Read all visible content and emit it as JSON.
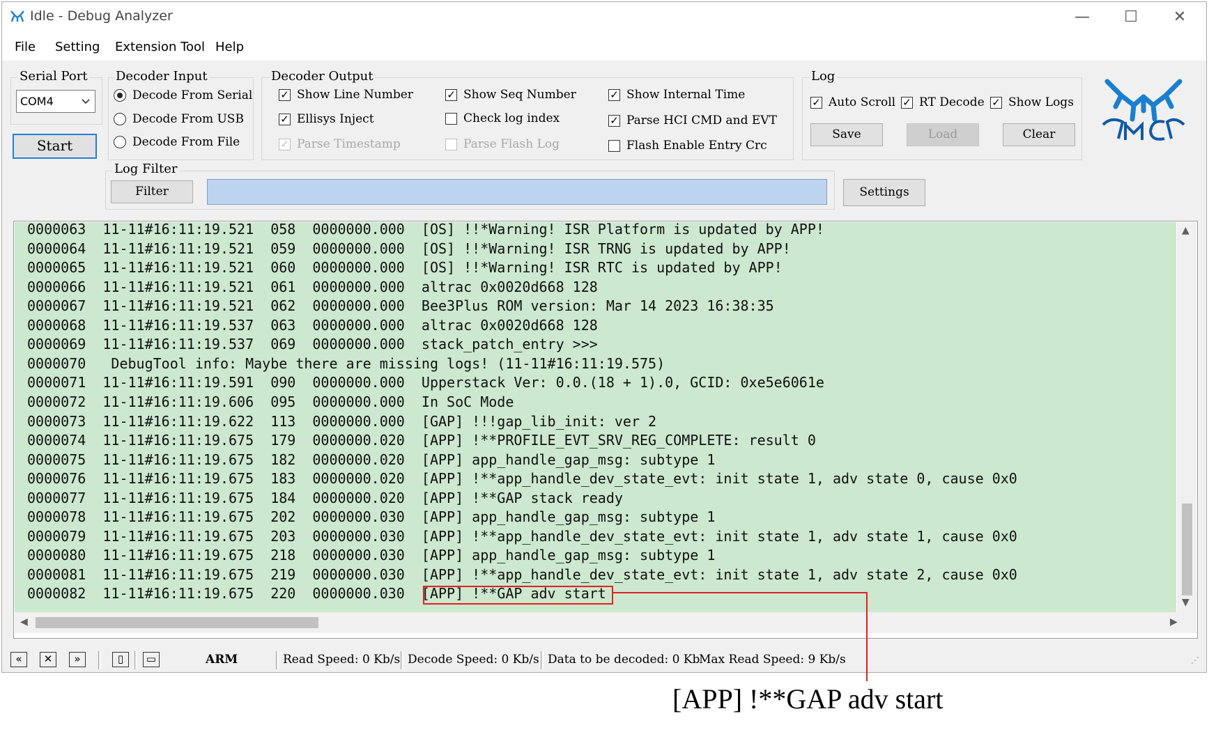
{
  "window": {
    "title": "Idle - Debug Analyzer",
    "controls": [
      "minimize-icon",
      "maximize-icon",
      "close-icon"
    ]
  },
  "menu": [
    "File",
    "Setting",
    "Extension Tool",
    "Help"
  ],
  "serial_port": {
    "label": "Serial Port",
    "selected": "COM4",
    "start_label": "Start"
  },
  "decoder_input": {
    "label": "Decoder Input",
    "options": [
      {
        "label": "Decode From Serial",
        "selected": true
      },
      {
        "label": "Decode From USB",
        "selected": false
      },
      {
        "label": "Decode From File",
        "selected": false
      }
    ]
  },
  "decoder_output": {
    "label": "Decoder Output",
    "options": [
      {
        "label": "Show Line Number",
        "checked": true,
        "enabled": true
      },
      {
        "label": "Ellisys Inject",
        "checked": true,
        "enabled": true
      },
      {
        "label": "Parse Timestamp",
        "checked": true,
        "enabled": false
      },
      {
        "label": "Show Seq Number",
        "checked": true,
        "enabled": true
      },
      {
        "label": "Check log index",
        "checked": false,
        "enabled": true
      },
      {
        "label": "Parse Flash Log",
        "checked": false,
        "enabled": false
      },
      {
        "label": "Show Internal Time",
        "checked": true,
        "enabled": true
      },
      {
        "label": "Parse HCI CMD and EVT",
        "checked": true,
        "enabled": true
      },
      {
        "label": "Flash Enable Entry Crc",
        "checked": false,
        "enabled": true
      }
    ]
  },
  "log": {
    "label": "Log",
    "options": [
      {
        "label": "Auto Scroll",
        "checked": true
      },
      {
        "label": "RT Decode",
        "checked": true
      },
      {
        "label": "Show Logs",
        "checked": true
      }
    ],
    "save_label": "Save",
    "load_label": "Load",
    "clear_label": "Clear"
  },
  "log_filter": {
    "label": "Log Filter",
    "filter_label": "Filter",
    "value": "",
    "settings_label": "Settings"
  },
  "log_lines": [
    "0000063  11-11#16:11:19.521  058  0000000.000  [OS] !!*Warning! ISR Platform is updated by APP!",
    "0000064  11-11#16:11:19.521  059  0000000.000  [OS] !!*Warning! ISR TRNG is updated by APP!",
    "0000065  11-11#16:11:19.521  060  0000000.000  [OS] !!*Warning! ISR RTC is updated by APP!",
    "0000066  11-11#16:11:19.521  061  0000000.000  altrac 0x0020d668 128",
    "0000067  11-11#16:11:19.521  062  0000000.000  Bee3Plus ROM version: Mar 14 2023 16:38:35",
    "0000068  11-11#16:11:19.537  063  0000000.000  altrac 0x0020d668 128",
    "0000069  11-11#16:11:19.537  069  0000000.000  stack_patch_entry >>>",
    "0000070   DebugTool info: Maybe there are missing logs! (11-11#16:11:19.575)",
    "0000071  11-11#16:11:19.591  090  0000000.000  Upperstack Ver: 0.0.(18 + 1).0, GCID: 0xe5e6061e",
    "0000072  11-11#16:11:19.606  095  0000000.000  In SoC Mode",
    "0000073  11-11#16:11:19.622  113  0000000.000  [GAP] !!!gap_lib_init: ver 2",
    "0000074  11-11#16:11:19.675  179  0000000.020  [APP] !**PROFILE_EVT_SRV_REG_COMPLETE: result 0",
    "0000075  11-11#16:11:19.675  182  0000000.020  [APP] app_handle_gap_msg: subtype 1",
    "0000076  11-11#16:11:19.675  183  0000000.020  [APP] !**app_handle_dev_state_evt: init state 1, adv state 0, cause 0x0",
    "0000077  11-11#16:11:19.675  184  0000000.020  [APP] !**GAP stack ready",
    "0000078  11-11#16:11:19.675  202  0000000.030  [APP] app_handle_gap_msg: subtype 1",
    "0000079  11-11#16:11:19.675  203  0000000.030  [APP] !**app_handle_dev_state_evt: init state 1, adv state 1, cause 0x0",
    "0000080  11-11#16:11:19.675  218  0000000.030  [APP] app_handle_gap_msg: subtype 1",
    "0000081  11-11#16:11:19.675  219  0000000.030  [APP] !**app_handle_dev_state_evt: init state 1, adv state 2, cause 0x0",
    "0000082  11-11#16:11:19.675  220  0000000.030  [APP] !**GAP adv start"
  ],
  "status": {
    "arch": "ARM",
    "read_speed": "Read Speed:  0 Kb/s",
    "decode_speed": "Decode Speed:  0 Kb/s",
    "data_to_decode": "Data to be decoded:  0 Kb",
    "max_read_speed": "Max Read Speed:  9 Kb/s"
  },
  "callout": "[APP] !**GAP adv start",
  "colors": {
    "log_background": "#cce8cf",
    "filter_input": "#bcd4ee",
    "highlight": "#e02020",
    "logo": "#1a7fd0"
  }
}
